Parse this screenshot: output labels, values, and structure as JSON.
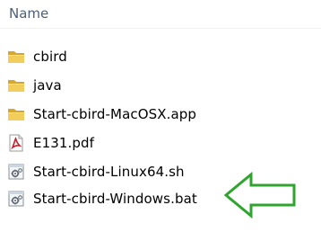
{
  "header": {
    "name_column": "Name"
  },
  "files": [
    {
      "name": "cbird",
      "icon": "folder-icon"
    },
    {
      "name": "java",
      "icon": "folder-icon"
    },
    {
      "name": "Start-cbird-MacOSX.app",
      "icon": "folder-icon"
    },
    {
      "name": "E131.pdf",
      "icon": "pdf-icon"
    },
    {
      "name": "Start-cbird-Linux64.sh",
      "icon": "script-icon"
    },
    {
      "name": "Start-cbird-Windows.bat",
      "icon": "script-icon"
    }
  ],
  "annotation": {
    "arrow_color": "#2fa52f",
    "arrow_direction": "left",
    "points_to": "Start-cbird-Windows.bat"
  },
  "colors": {
    "header_text": "#4c607a",
    "folder_yellow": "#e8b93a",
    "pdf_red": "#c8202a"
  }
}
